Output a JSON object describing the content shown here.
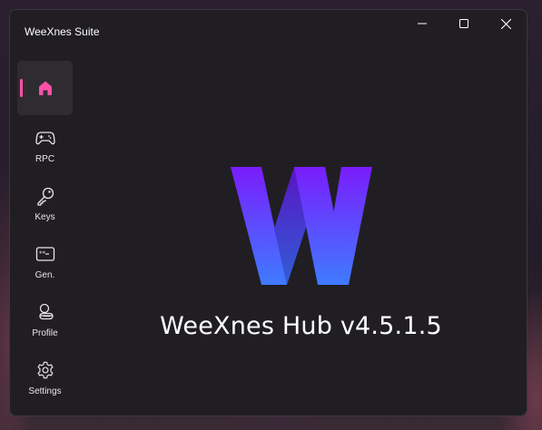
{
  "window": {
    "title": "WeeXnes Suite"
  },
  "controls": [
    "minimize-icon",
    "maximize-icon",
    "close-icon"
  ],
  "sidebar": {
    "items": [
      {
        "id": "home",
        "label": "",
        "icon": "home-icon",
        "active": true
      },
      {
        "id": "rpc",
        "label": "RPC",
        "icon": "gamepad-icon",
        "active": false
      },
      {
        "id": "keys",
        "label": "Keys",
        "icon": "key-icon",
        "active": false
      },
      {
        "id": "gen",
        "label": "Gen.",
        "icon": "password-icon",
        "active": false
      },
      {
        "id": "profile",
        "label": "Profile",
        "icon": "profile-icon",
        "active": false
      },
      {
        "id": "settings",
        "label": "Settings",
        "icon": "gear-icon",
        "active": false
      }
    ]
  },
  "main": {
    "title": "WeeXnes Hub v4.5.1.5",
    "logo": "weexnes-w-logo"
  },
  "colors": {
    "accent": "#ff4fa7",
    "window_bg": "#201e23",
    "logo_gradient_top": "#7a1dfc",
    "logo_gradient_bottom": "#3f7bff"
  }
}
